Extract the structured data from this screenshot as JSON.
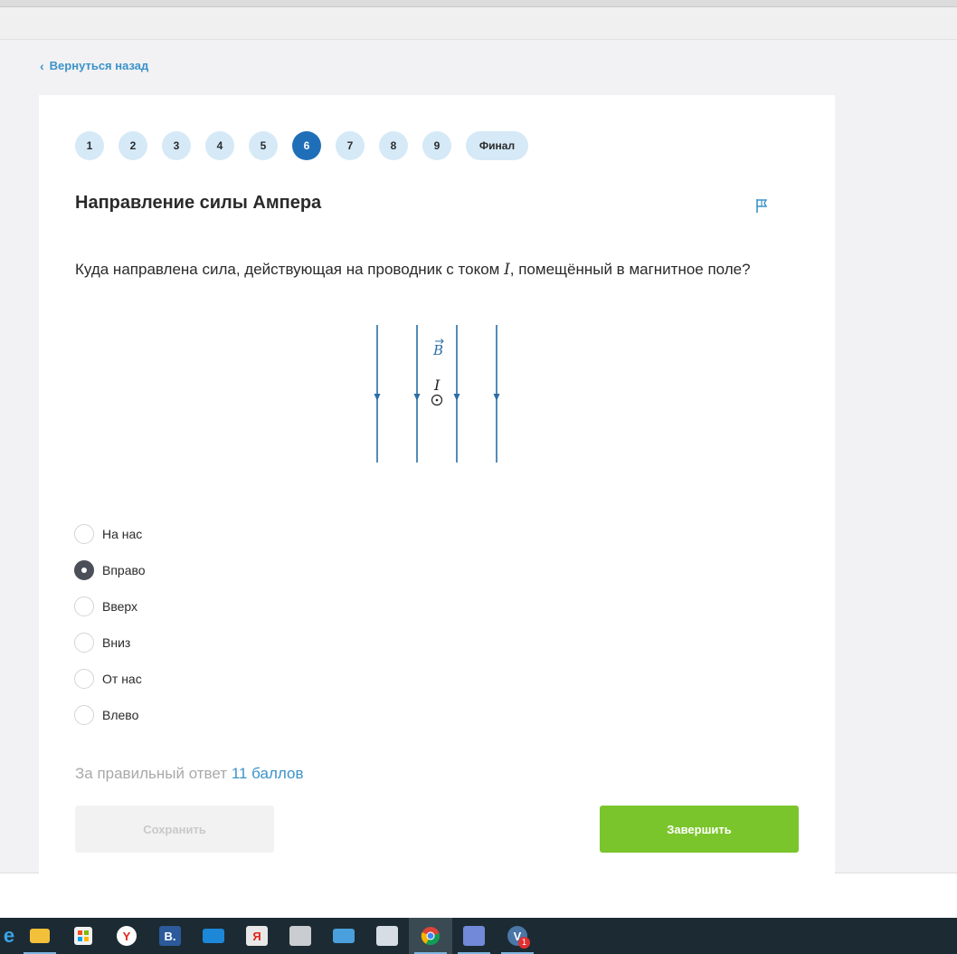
{
  "nav": {
    "back_label": "Вернуться назад"
  },
  "steps": [
    "1",
    "2",
    "3",
    "4",
    "5",
    "6",
    "7",
    "8",
    "9",
    "Финал"
  ],
  "active_step": "6",
  "task": {
    "title": "Направление силы Ампера",
    "question_before": "Куда направлена сила, действующая на проводник с током ",
    "question_var": "I",
    "question_after": ", помещённый в магнитное поле?"
  },
  "diagram": {
    "field_label": "B",
    "current_label": "I"
  },
  "options": [
    {
      "label": "На нас",
      "checked": false
    },
    {
      "label": "Вправо",
      "checked": true
    },
    {
      "label": "Вверх",
      "checked": false
    },
    {
      "label": "Вниз",
      "checked": false
    },
    {
      "label": "От нас",
      "checked": false
    },
    {
      "label": "Влево",
      "checked": false
    }
  ],
  "points": {
    "prefix": "За правильный ответ",
    "value": "11 баллов"
  },
  "buttons": {
    "save_label": "Сохранить",
    "finish_label": "Завершить"
  },
  "colors": {
    "accent": "#3b93c9",
    "active_step": "#1f6fb8",
    "finish_button": "#7ac52b",
    "field_lines": "#2a6ea6"
  },
  "taskbar": {
    "icons": [
      "edge-icon",
      "file-explorer-icon",
      "store-icon",
      "yandex-browser-icon",
      "b-app-icon",
      "mail-icon",
      "yandex-icon",
      "photos-icon",
      "control-panel-icon",
      "task-manager-icon",
      "chrome-icon",
      "discord-icon",
      "vk-icon"
    ],
    "vk_badge": "1"
  }
}
